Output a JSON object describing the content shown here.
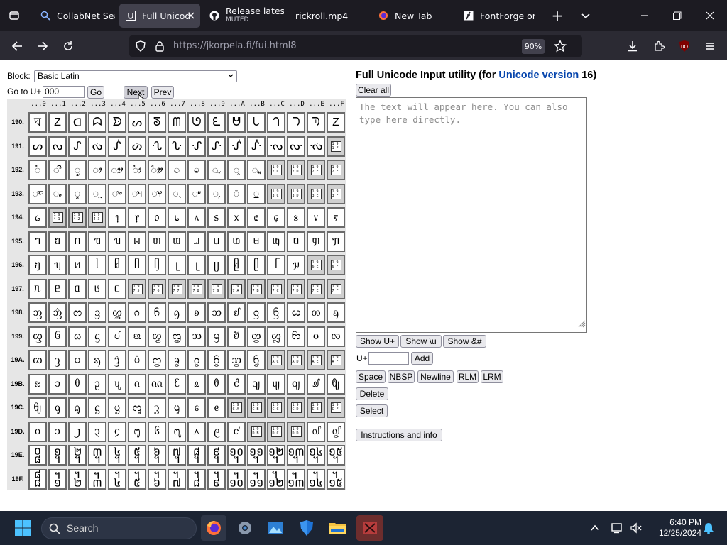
{
  "browser": {
    "tabs": [
      {
        "title": "CollabNet Sea",
        "icon": "search-icon"
      },
      {
        "title": "Full Unicod",
        "icon": "unicode-icon",
        "active": true
      },
      {
        "title": "Release latest",
        "subtitle": "MUTED",
        "icon": "github-icon"
      },
      {
        "title": "rickroll.mp4",
        "icon": ""
      },
      {
        "title": "New Tab",
        "icon": "firefox-icon"
      },
      {
        "title": "FontForge on",
        "icon": "fontforge-icon"
      }
    ],
    "url": "https://jkorpela.fi/fui.html8",
    "zoom": "90%"
  },
  "page": {
    "block_label": "Block:",
    "block_value": "Basic Latin",
    "goto_label": "Go to U+",
    "goto_value": "000",
    "go_button": "Go",
    "next_button": "Next",
    "prev_button": "Prev",
    "title_prefix": "Full Unicode Input utility (for ",
    "title_link": "Unicode version",
    "title_suffix": " 16)",
    "clear_all": "Clear all",
    "textarea_placeholder": "The text will appear here. You can also type here directly.",
    "show_uplus": "Show U+",
    "show_backslash_u": "Show \\u",
    "show_amp": "Show &#",
    "uplus_label": "U+",
    "add_button": "Add",
    "space_button": "Space",
    "nbsp_button": "NBSP",
    "newline_button": "Newline",
    "rlm_button": "RLM",
    "lrm_button": "LRM",
    "delete_button": "Delete",
    "select_button": "Select",
    "instructions_button": "Instructions and info"
  },
  "grid": {
    "col_headers": [
      "...0",
      "...1",
      "...2",
      "...3",
      "...4",
      "...5",
      "...6",
      "...7",
      "...8",
      "...9",
      "...A",
      "...B",
      "...C",
      "...D",
      "...E",
      "...F"
    ],
    "rows": [
      {
        "label": "190.",
        "chars": [
          "ঘ",
          "Z",
          "ᗡ",
          "ᗣ",
          "ᗦ",
          "ᔕ",
          "ᘕ",
          "ᗰ",
          "ᘎ",
          "ᘍ",
          "ᕰ",
          "ᘂ",
          "ᘃ",
          "ᘄ",
          "ᘅ",
          "Z"
        ]
      },
      {
        "label": "191.",
        "chars": [
          "ᔕ",
          "ᔓ",
          "ᔑ",
          "ᔔ",
          "ᔒ",
          "ᔖ",
          "ᔗ",
          "ᔘ",
          "ᔙ",
          "ᔚ",
          "ᔛ",
          "ᔜ",
          "ᔝ",
          "ᔞ",
          "ᔟ",
          "#191F"
        ]
      },
      {
        "label": "192.",
        "chars": [
          "◌ᤠ",
          "◌ᤡ",
          "◌ᤢ",
          "◌ᤣ",
          "◌ᤤ",
          "◌ᤥ",
          "◌ᤦ",
          "◌ᤧ",
          "◌ᤨ",
          "◌ᤩ",
          "◌ᤪ",
          "◌ᤫ",
          "#192C",
          "#192D",
          "#192E",
          "#192F"
        ]
      },
      {
        "label": "193.",
        "chars": [
          "◌ᤰ",
          "◌ᤱ",
          "◌ᤲ",
          "◌ᤳ",
          "◌ᤴ",
          "◌ᤵ",
          "◌ᤶ",
          "◌ᤷ",
          "◌ᤸ",
          "◌᤹",
          "◌᤺",
          "◌᤻",
          "#193C",
          "#193D",
          "#193E",
          "#193F"
        ]
      },
      {
        "label": "194.",
        "chars": [
          "᥀",
          "#1941",
          "#1942",
          "#1943",
          "᥄",
          "᥅",
          "᥆",
          "᥇",
          "᥈",
          "᥉",
          "᥊",
          "᥋",
          "᥌",
          "᥍",
          "᥎",
          "᥏"
        ]
      },
      {
        "label": "195.",
        "chars": [
          "ᥐ",
          "ᥑ",
          "ᥒ",
          "ᥓ",
          "ᥔ",
          "ᥕ",
          "ᥖ",
          "ᥗ",
          "ᥘ",
          "ᥙ",
          "ᥚ",
          "ᥛ",
          "ᥜ",
          "ᥝ",
          "ᥞ",
          "ᥟ"
        ]
      },
      {
        "label": "196.",
        "chars": [
          "ᥠ",
          "ᥡ",
          "ᥢ",
          "ᥣ",
          "ᥤ",
          "ᥥ",
          "ᥦ",
          "ᥧ",
          "ᥨ",
          "ᥩ",
          "ᥪ",
          "ᥫ",
          "ᥬ",
          "ᥭ",
          "#196E",
          "#196F"
        ]
      },
      {
        "label": "197.",
        "chars": [
          "ᥰ",
          "ᥱ",
          "ᥲ",
          "ᥳ",
          "ᥴ",
          "#1975",
          "#1976",
          "#1977",
          "#1978",
          "#1979",
          "#197A",
          "#197B",
          "#197C",
          "#197D",
          "#197E",
          "#197F"
        ]
      },
      {
        "label": "198.",
        "chars": [
          "ᦀ",
          "ᦁ",
          "ᦂ",
          "ᦃ",
          "ᦄ",
          "ᦅ",
          "ᦆ",
          "ᦇ",
          "ᦈ",
          "ᦉ",
          "ᦊ",
          "ᦋ",
          "ᦌ",
          "ᦍ",
          "ᦎ",
          "ᦏ"
        ]
      },
      {
        "label": "199.",
        "chars": [
          "ᦐ",
          "ᦑ",
          "ᦒ",
          "ᦓ",
          "ᦔ",
          "ᦕ",
          "ᦖ",
          "ᦗ",
          "ᦘ",
          "ᦙ",
          "ᦚ",
          "ᦛ",
          "ᦜ",
          "ᦝ",
          "ᦞ",
          "ᦟ"
        ]
      },
      {
        "label": "19A.",
        "chars": [
          "ᦠ",
          "ᦡ",
          "ᦢ",
          "ᦣ",
          "ᦤ",
          "ᦥ",
          "ᦦ",
          "ᦧ",
          "ᦨ",
          "ᦩ",
          "ᦪ",
          "ᦫ",
          "#19AC",
          "#19AD",
          "#19AE",
          "#19AF"
        ]
      },
      {
        "label": "19B.",
        "chars": [
          "ᦰ",
          "ᦱ",
          "ᦲ",
          "ᦳ",
          "ᦴ",
          "ᦵ",
          "ᦶ",
          "ᦷ",
          "ᦸ",
          "ᦹ",
          "ᦺ",
          "ᦻ",
          "ᦼ",
          "ᦽ",
          "ᦾ",
          "ᦿ"
        ]
      },
      {
        "label": "19C.",
        "chars": [
          "ᧀ",
          "ᧁ",
          "ᧂ",
          "ᧃ",
          "ᧄ",
          "ᧅ",
          "ᧆ",
          "ᧇ",
          "ᧈ",
          "ᧉ",
          "#19CA",
          "#19CB",
          "#19CC",
          "#19CD",
          "#19CE",
          "#19CF"
        ]
      },
      {
        "label": "19D.",
        "chars": [
          "᧐",
          "᧑",
          "᧒",
          "᧓",
          "᧔",
          "᧕",
          "᧖",
          "᧗",
          "᧘",
          "᧙",
          "᧚",
          "#19DB",
          "#19DC",
          "#19DD",
          "᧞",
          "᧟"
        ]
      },
      {
        "label": "19E.",
        "chars": [
          "᧠",
          "᧡",
          "᧢",
          "᧣",
          "᧤",
          "᧥",
          "᧦",
          "᧧",
          "᧨",
          "᧩",
          "᧪",
          "᧫",
          "᧬",
          "᧭",
          "᧮",
          "᧯"
        ]
      },
      {
        "label": "19F.",
        "chars": [
          "᧰",
          "᧱",
          "᧲",
          "᧳",
          "᧴",
          "᧵",
          "᧶",
          "᧷",
          "᧸",
          "᧹",
          "᧺",
          "᧻",
          "᧼",
          "᧽",
          "᧾",
          "᧿"
        ]
      }
    ]
  },
  "taskbar": {
    "search_placeholder": "Search",
    "time": "6:40 PM",
    "date": "12/25/2024"
  }
}
